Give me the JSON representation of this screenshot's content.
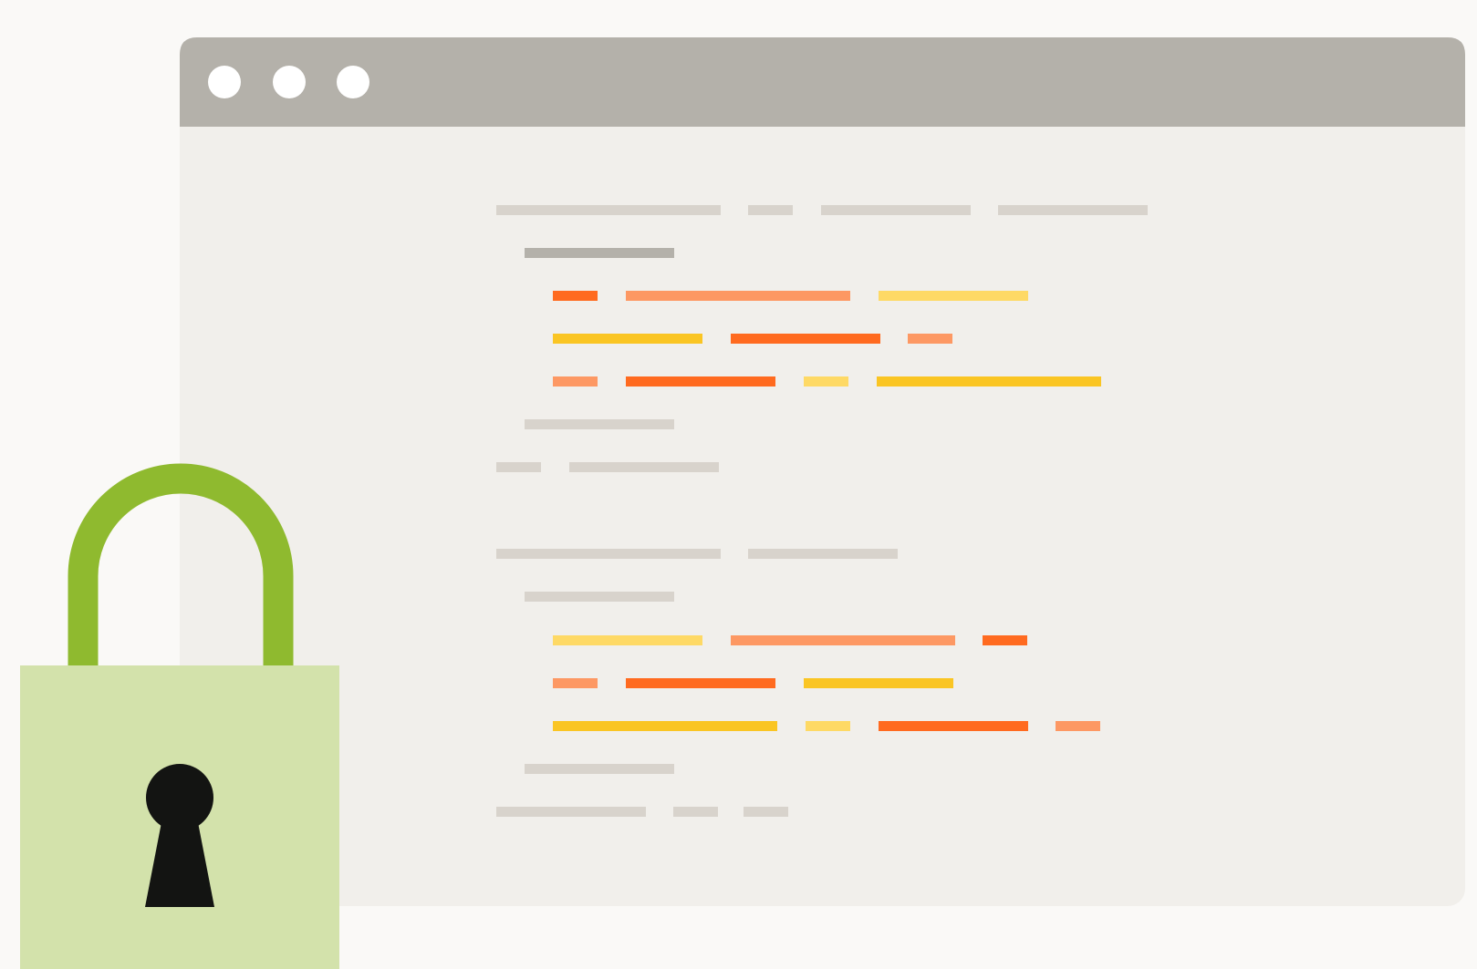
{
  "colors": {
    "page_background": "#faf9f7",
    "window_titlebar": "#b4b1aa",
    "window_body": "#f1efeb",
    "window_control_dot": "#ffffff",
    "code_placeholder_light": "#d8d3cc",
    "code_placeholder_dark": "#b4b1aa",
    "code_orange": "#ff6a1f",
    "code_salmon": "#fd9863",
    "code_yellow": "#fac523",
    "code_pale_yellow": "#fed965",
    "lock_shackle": "#8fba2f",
    "lock_body": "#d3e2ab",
    "keyhole": "#131412"
  },
  "window": {
    "controls": [
      "window-dot-1",
      "window-dot-2",
      "window-dot-3"
    ]
  },
  "icons": {
    "lock": "padlock-icon",
    "keyhole": "keyhole-icon"
  }
}
